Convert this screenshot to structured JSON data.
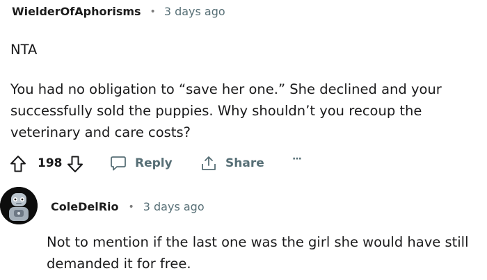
{
  "comment": {
    "username": "WielderOfAphorisms",
    "separator": "•",
    "time": "3 days ago",
    "line1": "NTA",
    "line2": "You had no obligation to “save her one.” She declined and your successfully sold the puppies. Why shouldn’t you recoup the veterinary and care costs?",
    "votes": "198",
    "reply_label": "Reply",
    "share_label": "Share",
    "more_label": "···"
  },
  "reply": {
    "username": "ColeDelRio",
    "separator": "•",
    "time": "3 days ago",
    "text": "Not to mention if the last one was the girl she would have still demanded it for free."
  }
}
